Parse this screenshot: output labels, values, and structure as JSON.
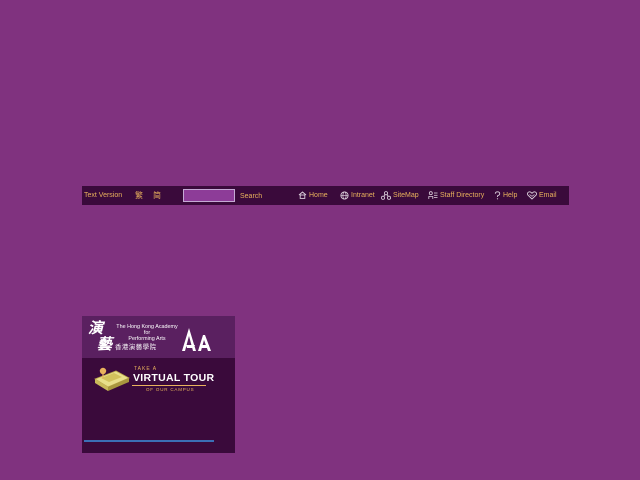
{
  "topbar": {
    "text_version": "Text Version",
    "lang_traditional": "繁",
    "lang_simplified": "简",
    "search": {
      "value": "",
      "placeholder": "",
      "button_label": "Search"
    },
    "nav": [
      {
        "label": "Home",
        "icon": "home-icon"
      },
      {
        "label": "Intranet",
        "icon": "globe-icon"
      },
      {
        "label": "SiteMap",
        "icon": "sitemap-icon"
      },
      {
        "label": "Staff Directory",
        "icon": "people-icon"
      },
      {
        "label": "Help",
        "icon": "question-icon"
      },
      {
        "label": "Email",
        "icon": "heart-email-icon"
      }
    ]
  },
  "banner": {
    "calligraphy": [
      "演",
      "藝"
    ],
    "org_name_en": [
      "The Hong Kong Academy",
      "for",
      "Performing Arts"
    ],
    "org_name_zh": "香港演藝學院",
    "virtual_tour": {
      "take": "TAKE A",
      "title": "VIRTUAL TOUR",
      "subtitle": "OF OUR CAMPUS"
    }
  },
  "colors": {
    "page_background": "#80327f",
    "bar_background": "#3a0a3b",
    "link_gold": "#e9b25d",
    "banner_header": "#5a2060",
    "progress_blue": "#3b6fb6"
  }
}
